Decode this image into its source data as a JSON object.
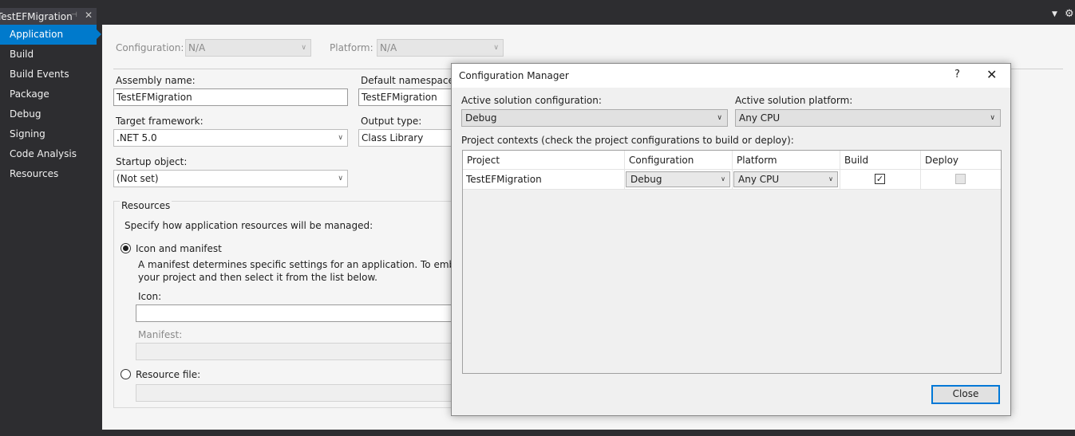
{
  "document_tab": {
    "title": "TestEFMigration",
    "pin_icon": "pin-icon",
    "close_icon": "close-icon"
  },
  "sidebar": {
    "items": [
      {
        "label": "Application",
        "active": true
      },
      {
        "label": "Build"
      },
      {
        "label": "Build Events"
      },
      {
        "label": "Package"
      },
      {
        "label": "Debug"
      },
      {
        "label": "Signing"
      },
      {
        "label": "Code Analysis"
      },
      {
        "label": "Resources"
      }
    ]
  },
  "app_page": {
    "configuration_label": "Configuration:",
    "configuration_value": "N/A",
    "platform_label": "Platform:",
    "platform_value": "N/A",
    "assembly_name_label": "Assembly name:",
    "assembly_name_value": "TestEFMigration",
    "default_namespace_label": "Default namespace:",
    "default_namespace_value": "TestEFMigration",
    "target_framework_label": "Target framework:",
    "target_framework_value": ".NET 5.0",
    "output_type_label": "Output type:",
    "output_type_value": "Class Library",
    "startup_object_label": "Startup object:",
    "startup_object_value": "(Not set)",
    "resources": {
      "group_label": "Resources",
      "description": "Specify how application resources will be managed:",
      "icon_manifest_label": "Icon and manifest",
      "icon_manifest_desc_line1": "A manifest determines specific settings for an application. To embed a cust",
      "icon_manifest_desc_line2": "your project and then select it from the list below.",
      "icon_label": "Icon:",
      "icon_value": "",
      "manifest_label": "Manifest:",
      "manifest_value": "",
      "resource_file_label": "Resource file:",
      "resource_file_value": ""
    }
  },
  "dialog": {
    "title": "Configuration Manager",
    "help_glyph": "?",
    "close_glyph": "✕",
    "active_config_label": "Active solution configuration:",
    "active_config_value": "Debug",
    "active_platform_label": "Active solution platform:",
    "active_platform_value": "Any CPU",
    "project_contexts_label": "Project contexts (check the project configurations to build or deploy):",
    "columns": [
      "Project",
      "Configuration",
      "Platform",
      "Build",
      "Deploy"
    ],
    "rows": [
      {
        "project": "TestEFMigration",
        "configuration": "Debug",
        "platform": "Any CPU",
        "build": true,
        "deploy": false
      }
    ],
    "close_button": "Close"
  },
  "colors": {
    "accent": "#007acc",
    "chrome": "#2d2d30",
    "dialog_bg": "#f0f0f0"
  }
}
